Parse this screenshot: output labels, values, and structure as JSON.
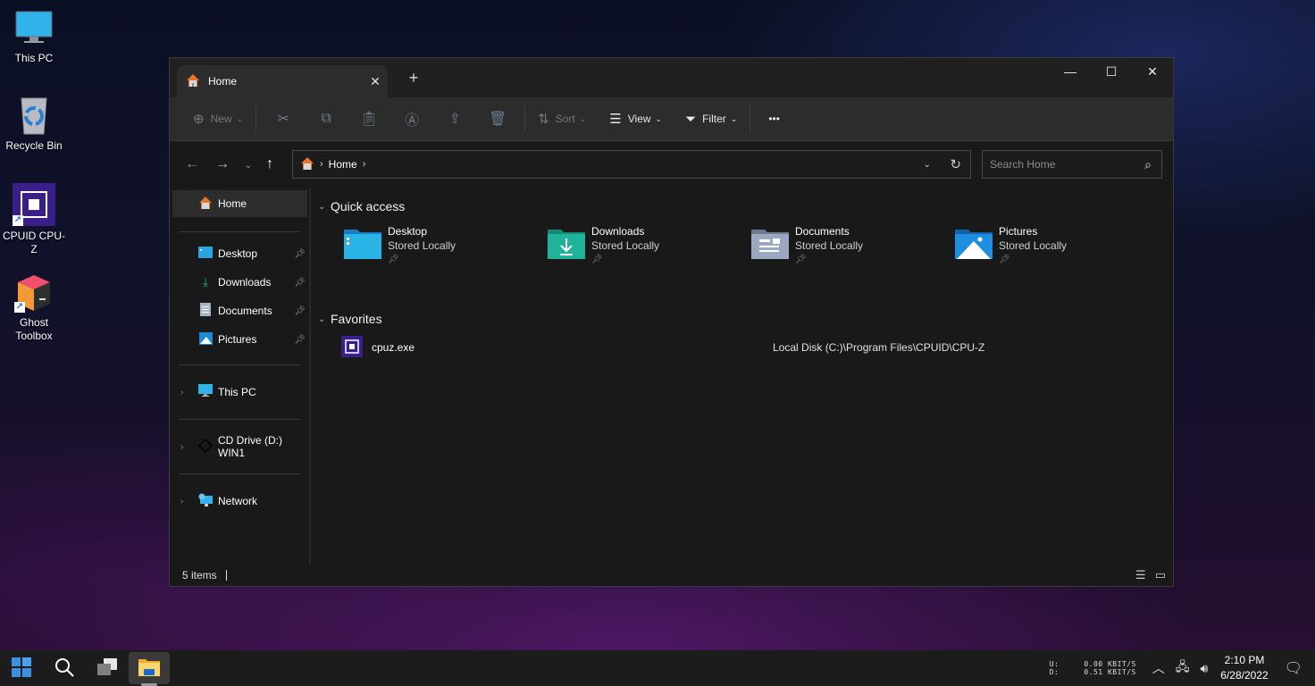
{
  "desktop": {
    "icons": [
      {
        "label": "This PC",
        "icon": "monitor-icon"
      },
      {
        "label": "Recycle Bin",
        "icon": "recycle-bin-icon"
      },
      {
        "label": "CPUID CPU-Z",
        "icon": "cpuz-icon",
        "shortcut": true
      },
      {
        "label": "Ghost Toolbox",
        "icon": "ghost-toolbox-icon",
        "shortcut": true
      }
    ]
  },
  "explorer": {
    "tab": {
      "label": "Home",
      "icon": "home-icon"
    },
    "toolbar": {
      "new_label": "New",
      "sort_label": "Sort",
      "view_label": "View",
      "filter_label": "Filter",
      "more_label": "•••"
    },
    "address": {
      "crumbs": [
        "Home"
      ]
    },
    "search": {
      "placeholder": "Search Home"
    },
    "sidebar": {
      "home": "Home",
      "pinned": [
        {
          "label": "Desktop",
          "icon": "desktop-folder-icon"
        },
        {
          "label": "Downloads",
          "icon": "download-icon"
        },
        {
          "label": "Documents",
          "icon": "documents-icon"
        },
        {
          "label": "Pictures",
          "icon": "pictures-icon"
        }
      ],
      "this_pc": "This PC",
      "cd_drive": "CD Drive (D:) WIN1",
      "network": "Network"
    },
    "quick_access": {
      "title": "Quick access",
      "items": [
        {
          "name": "Desktop",
          "sub": "Stored Locally"
        },
        {
          "name": "Downloads",
          "sub": "Stored Locally"
        },
        {
          "name": "Documents",
          "sub": "Stored Locally"
        },
        {
          "name": "Pictures",
          "sub": "Stored Locally"
        }
      ]
    },
    "favorites": {
      "title": "Favorites",
      "items": [
        {
          "name": "cpuz.exe",
          "path": "Local Disk (C:)\\Program Files\\CPUID\\CPU-Z"
        }
      ]
    },
    "status": {
      "items": "5 items"
    }
  },
  "taskbar": {
    "netmon": {
      "u_label": "U:",
      "d_label": "D:",
      "u_value": "0.00 KBIT/S",
      "d_value": "0.51 KBIT/S"
    },
    "time": "2:10 PM",
    "date": "6/28/2022"
  }
}
